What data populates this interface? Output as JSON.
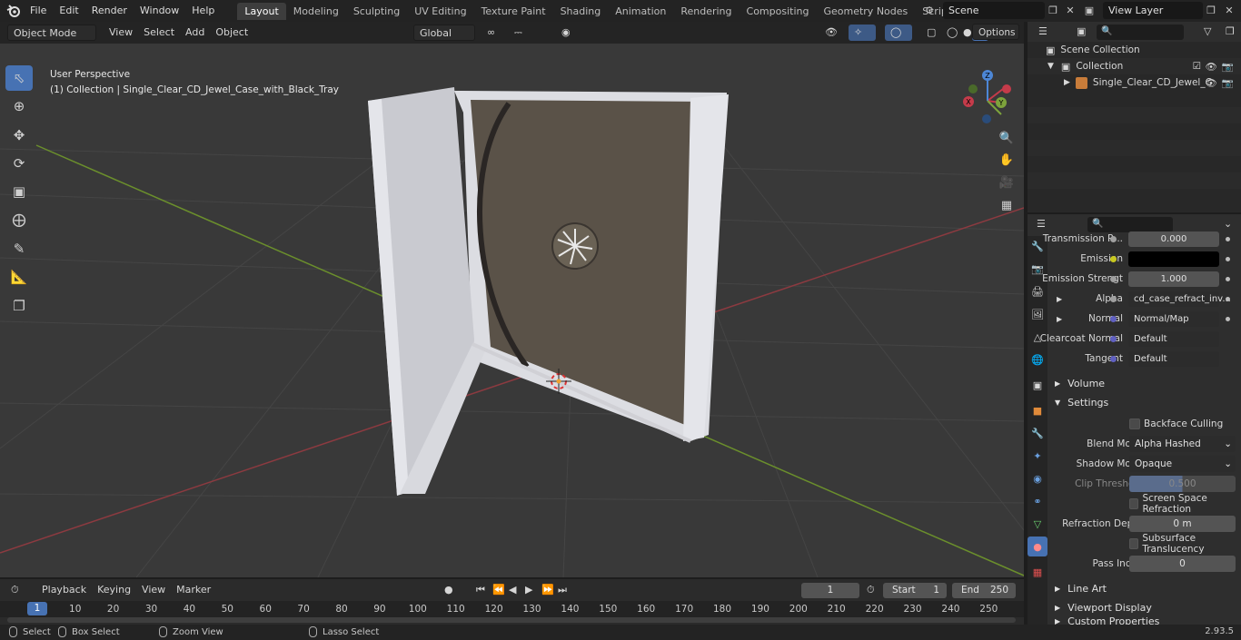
{
  "app": {
    "menu": [
      "File",
      "Edit",
      "Render",
      "Window",
      "Help"
    ],
    "workspaces": [
      "Layout",
      "Modeling",
      "Sculpting",
      "UV Editing",
      "Texture Paint",
      "Shading",
      "Animation",
      "Rendering",
      "Compositing",
      "Geometry Nodes",
      "Scripting"
    ],
    "active_workspace": "Layout",
    "scene": "Scene",
    "view_layer": "View Layer"
  },
  "viewport": {
    "mode": "Object Mode",
    "menus": [
      "View",
      "Select",
      "Add",
      "Object"
    ],
    "transform_orientation": "Global",
    "options": "Options",
    "perspective_label": "User Perspective",
    "collection_label": "(1) Collection | Single_Clear_CD_Jewel_Case_with_Black_Tray",
    "gizmo_axes": {
      "x": "X",
      "y": "Y",
      "z": "Z"
    }
  },
  "outliner": {
    "scene_collection": "Scene Collection",
    "collection": "Collection",
    "object": "Single_Clear_CD_Jewel_C"
  },
  "properties": {
    "rows": [
      {
        "label": "Transmission R...",
        "value": "0.000",
        "type": "num"
      },
      {
        "label": "Emission",
        "value": "",
        "type": "color"
      },
      {
        "label": "Emission Strengt",
        "value": "1.000",
        "type": "num"
      },
      {
        "label": "Alpha",
        "value": "cd_case_refract_inv...",
        "type": "link"
      },
      {
        "label": "Normal",
        "value": "Normal/Map",
        "type": "link"
      },
      {
        "label": "Clearcoat Normal",
        "value": "Default",
        "type": "link"
      },
      {
        "label": "Tangent",
        "value": "Default",
        "type": "link"
      }
    ],
    "sections": {
      "volume": "Volume",
      "settings": "Settings",
      "line_art": "Line Art",
      "viewport_display": "Viewport Display",
      "custom_properties": "Custom Properties"
    },
    "settings": {
      "backface_culling": "Backface Culling",
      "blend_mode_label": "Blend Mode",
      "blend_mode": "Alpha Hashed",
      "shadow_mode_label": "Shadow Mode",
      "shadow_mode": "Opaque",
      "clip_threshold_label": "Clip Threshold",
      "clip_threshold": "0.500",
      "screen_space_refraction": "Screen Space Refraction",
      "refraction_depth_label": "Refraction Depth",
      "refraction_depth": "0 m",
      "subsurface_translucency": "Subsurface Translucency",
      "pass_index_label": "Pass Index",
      "pass_index": "0"
    }
  },
  "timeline": {
    "menus": [
      "Playback",
      "Keying",
      "View",
      "Marker"
    ],
    "current_frame": "1",
    "start_label": "Start",
    "start": "1",
    "end_label": "End",
    "end": "250",
    "ticks": [
      "1",
      "10",
      "20",
      "30",
      "40",
      "50",
      "60",
      "70",
      "80",
      "90",
      "100",
      "110",
      "120",
      "130",
      "140",
      "150",
      "160",
      "170",
      "180",
      "190",
      "200",
      "210",
      "220",
      "230",
      "240",
      "250"
    ]
  },
  "status": {
    "select": "Select",
    "box_select": "Box Select",
    "zoom_view": "Zoom View",
    "lasso_select": "Lasso Select",
    "version": "2.93.5"
  },
  "colors": {
    "accent": "#4772b3",
    "viewport_bg": "#3a3a3a",
    "x_axis": "#c53b4a",
    "y_axis": "#7da33c",
    "z_axis": "#4d87d6"
  }
}
